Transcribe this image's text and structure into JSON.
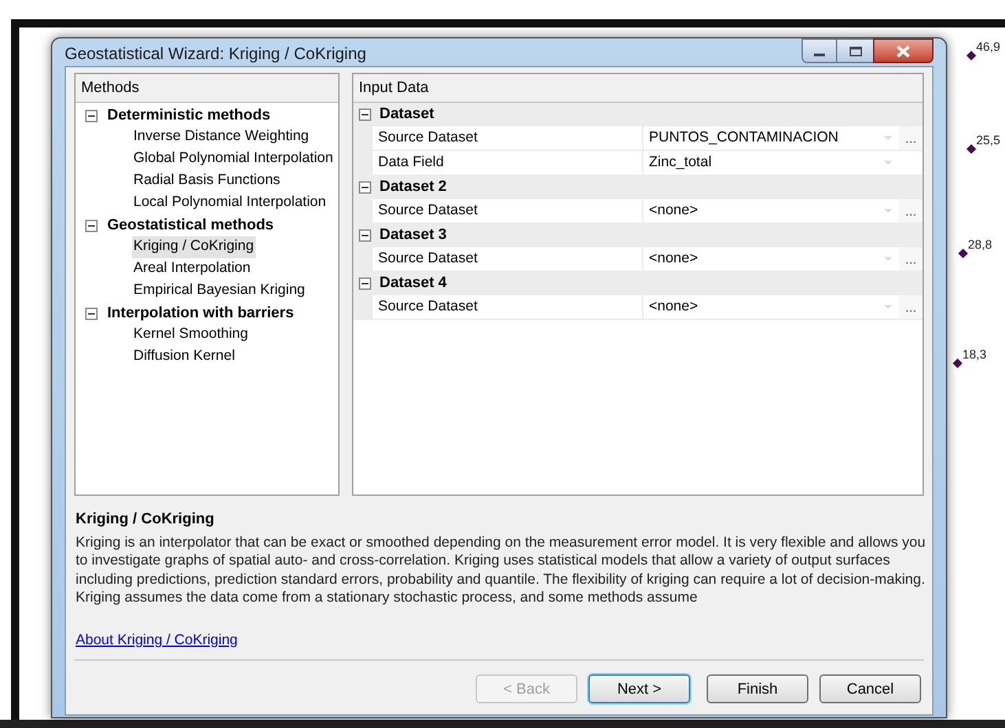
{
  "window": {
    "title": "Geostatistical Wizard: Kriging / CoKriging"
  },
  "methods": {
    "header": "Methods",
    "groups": [
      {
        "label": "Deterministic methods",
        "expanded": true,
        "children": [
          {
            "label": "Inverse Distance Weighting",
            "selected": false
          },
          {
            "label": "Global Polynomial Interpolation",
            "selected": false
          },
          {
            "label": "Radial Basis Functions",
            "selected": false
          },
          {
            "label": "Local Polynomial Interpolation",
            "selected": false
          }
        ]
      },
      {
        "label": "Geostatistical methods",
        "expanded": true,
        "children": [
          {
            "label": "Kriging / CoKriging",
            "selected": true
          },
          {
            "label": "Areal Interpolation",
            "selected": false
          },
          {
            "label": "Empirical Bayesian Kriging",
            "selected": false
          }
        ]
      },
      {
        "label": "Interpolation with barriers",
        "expanded": true,
        "children": [
          {
            "label": "Kernel Smoothing",
            "selected": false
          },
          {
            "label": "Diffusion Kernel",
            "selected": false
          }
        ]
      }
    ]
  },
  "input_data": {
    "header": "Input Data",
    "sections": [
      {
        "label": "Dataset",
        "expanded": true,
        "rows": [
          {
            "name": "Source Dataset",
            "value": "PUNTOS_CONTAMINACION",
            "browse": "..."
          },
          {
            "name": "Data Field",
            "value": "Zinc_total"
          }
        ]
      },
      {
        "label": "Dataset 2",
        "expanded": true,
        "rows": [
          {
            "name": "Source Dataset",
            "value": "<none>",
            "browse": "..."
          }
        ]
      },
      {
        "label": "Dataset 3",
        "expanded": true,
        "rows": [
          {
            "name": "Source Dataset",
            "value": "<none>",
            "browse": "..."
          }
        ]
      },
      {
        "label": "Dataset 4",
        "expanded": true,
        "rows": [
          {
            "name": "Source Dataset",
            "value": "<none>",
            "browse": "..."
          }
        ]
      }
    ]
  },
  "description": {
    "title": "Kriging / CoKriging",
    "text": "Kriging is an interpolator that can be exact or smoothed depending on the measurement error model. It is very flexible and allows you to investigate graphs of spatial auto- and cross-correlation. Kriging uses statistical models that allow a variety of output surfaces including predictions, prediction standard errors, probability and quantile. The flexibility of kriging can require a lot of decision-making. Kriging assumes the data come from a stationary stochastic process, and some methods assume",
    "link": "About Kriging / CoKriging"
  },
  "buttons": [
    {
      "label": "< Back",
      "disabled": true,
      "default": false
    },
    {
      "label": "Next >",
      "disabled": false,
      "default": true
    },
    {
      "label": "Finish",
      "disabled": false,
      "default": false
    },
    {
      "label": "Cancel",
      "disabled": false,
      "default": false
    }
  ],
  "map_labels": [
    "46,9",
    "25,5",
    "28,8",
    "18,3"
  ]
}
